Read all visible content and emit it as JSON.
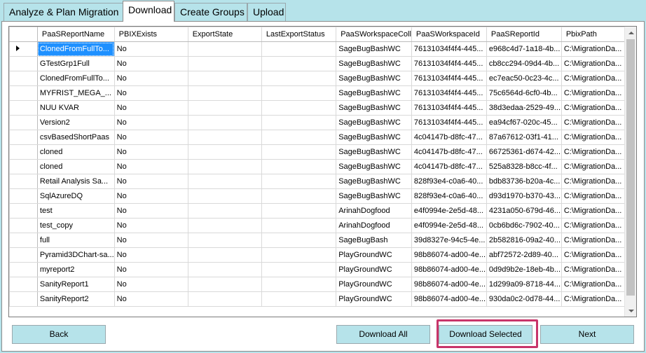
{
  "tabs": [
    {
      "label": "Analyze & Plan Migration",
      "active": false
    },
    {
      "label": "Download",
      "active": true
    },
    {
      "label": "Create Groups",
      "active": false
    },
    {
      "label": "Upload",
      "active": false
    }
  ],
  "grid": {
    "columns": [
      "PaaSReportName",
      "PBIXExists",
      "ExportState",
      "LastExportStatus",
      "PaaSWorkspaceColl",
      "PaaSWorkspaceId",
      "PaaSReportId",
      "PbixPath"
    ],
    "rows": [
      [
        "ClonedFromFullTo...",
        "No",
        "",
        "",
        "SageBugBashWC",
        "76131034f4f4-445...",
        "e968c4d7-1a18-4b...",
        "C:\\MigrationDa..."
      ],
      [
        "GTestGrp1Full",
        "No",
        "",
        "",
        "SageBugBashWC",
        "76131034f4f4-445...",
        "cb8cc294-09d4-4b...",
        "C:\\MigrationDa..."
      ],
      [
        "ClonedFromFullTo...",
        "No",
        "",
        "",
        "SageBugBashWC",
        "76131034f4f4-445...",
        "ec7eac50-0c23-4c...",
        "C:\\MigrationDa..."
      ],
      [
        "MYFRIST_MEGA_...",
        "No",
        "",
        "",
        "SageBugBashWC",
        "76131034f4f4-445...",
        "75c6564d-6cf0-4b...",
        "C:\\MigrationDa..."
      ],
      [
        "NUU KVAR",
        "No",
        "",
        "",
        "SageBugBashWC",
        "76131034f4f4-445...",
        "38d3edaa-2529-49...",
        "C:\\MigrationDa..."
      ],
      [
        "Version2",
        "No",
        "",
        "",
        "SageBugBashWC",
        "76131034f4f4-445...",
        "ea94cf67-020c-45...",
        "C:\\MigrationDa..."
      ],
      [
        "csvBasedShortPaas",
        "No",
        "",
        "",
        "SageBugBashWC",
        "4c04147b-d8fc-47...",
        "87a67612-03f1-41...",
        "C:\\MigrationDa..."
      ],
      [
        "cloned",
        "No",
        "",
        "",
        "SageBugBashWC",
        "4c04147b-d8fc-47...",
        "66725361-d674-42...",
        "C:\\MigrationDa..."
      ],
      [
        "cloned",
        "No",
        "",
        "",
        "SageBugBashWC",
        "4c04147b-d8fc-47...",
        "525a8328-b8cc-4f...",
        "C:\\MigrationDa..."
      ],
      [
        "Retail Analysis Sa...",
        "No",
        "",
        "",
        "SageBugBashWC",
        "828f93e4-c0a6-40...",
        "bdb83736-b20a-4c...",
        "C:\\MigrationDa..."
      ],
      [
        "SqlAzureDQ",
        "No",
        "",
        "",
        "SageBugBashWC",
        "828f93e4-c0a6-40...",
        "d93d1970-b370-43...",
        "C:\\MigrationDa..."
      ],
      [
        "test",
        "No",
        "",
        "",
        "ArinahDogfood",
        "e4f0994e-2e5d-48...",
        "4231a050-679d-46...",
        "C:\\MigrationDa..."
      ],
      [
        "test_copy",
        "No",
        "",
        "",
        "ArinahDogfood",
        "e4f0994e-2e5d-48...",
        "0cb6bd6c-7902-40...",
        "C:\\MigrationDa..."
      ],
      [
        "full",
        "No",
        "",
        "",
        "SageBugBash",
        "39d8327e-94c5-4e...",
        "2b582816-09a2-40...",
        "C:\\MigrationDa..."
      ],
      [
        "Pyramid3DChart-sa...",
        "No",
        "",
        "",
        "PlayGroundWC",
        "98b86074-ad00-4e...",
        "abf72572-2d89-40...",
        "C:\\MigrationDa..."
      ],
      [
        "myreport2",
        "No",
        "",
        "",
        "PlayGroundWC",
        "98b86074-ad00-4e...",
        "0d9d9b2e-18eb-4b...",
        "C:\\MigrationDa..."
      ],
      [
        "SanityReport1",
        "No",
        "",
        "",
        "PlayGroundWC",
        "98b86074-ad00-4e...",
        "1d299a09-8718-44...",
        "C:\\MigrationDa..."
      ],
      [
        "SanityReport2",
        "No",
        "",
        "",
        "PlayGroundWC",
        "98b86074-ad00-4e...",
        "930da0c2-0d78-44...",
        "C:\\MigrationDa..."
      ]
    ],
    "selected_row": 0
  },
  "buttons": {
    "back": "Back",
    "download_all": "Download All",
    "download_selected": "Download Selected",
    "next": "Next"
  },
  "colors": {
    "window_bg": "#b6e3ea",
    "selection": "#1e90ff",
    "highlight_box": "#c8356a"
  }
}
